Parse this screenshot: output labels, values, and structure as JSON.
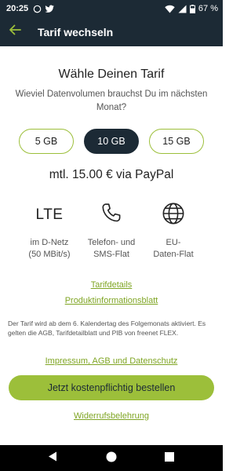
{
  "status_bar": {
    "time": "20:25",
    "left_icons": [
      "whatsapp-icon",
      "twitter-icon"
    ],
    "right_icons": [
      "wifi-icon",
      "signal-icon",
      "battery-icon"
    ],
    "battery": "67 %"
  },
  "app_bar": {
    "title": "Tarif wechseln",
    "back_icon": "arrow-left-icon"
  },
  "content": {
    "heading": "Wähle Deinen Tarif",
    "subheading": "Wieviel Datenvolumen brauchst Du im nächsten Monat?",
    "plans": [
      {
        "label": "5 GB",
        "selected": false
      },
      {
        "label": "10 GB",
        "selected": true
      },
      {
        "label": "15 GB",
        "selected": false
      }
    ],
    "price": "mtl. 15.00 € via PayPal",
    "features": [
      {
        "icon": "lte-text",
        "icon_text": "LTE",
        "line1": "im D-Netz",
        "line2": "(50 MBit/s)"
      },
      {
        "icon": "phone-icon",
        "line1": "Telefon- und",
        "line2": "SMS-Flat"
      },
      {
        "icon": "globe-icon",
        "line1": "EU-",
        "line2": "Daten-Flat"
      }
    ],
    "links": {
      "tariff_details": "Tarifdetails",
      "product_info": "Produktinformationsblatt",
      "imprint": "Impressum, AGB und Datenschutz",
      "withdrawal": "Widerrufsbelehrung"
    },
    "legal_text": "Der Tarif wird ab dem 6. Kalendertag des Folgemonats aktiviert. Es gelten die AGB, Tarifdetailblatt und PIB von freenet FLEX.",
    "order_button": "Jetzt kostenpflichtig bestellen"
  },
  "nav_bar": {
    "icons": [
      "back-triangle-icon",
      "home-circle-icon",
      "recents-square-icon"
    ]
  },
  "colors": {
    "dark": "#1c2a35",
    "accent": "#9cbf3a",
    "link": "#7fa523"
  }
}
